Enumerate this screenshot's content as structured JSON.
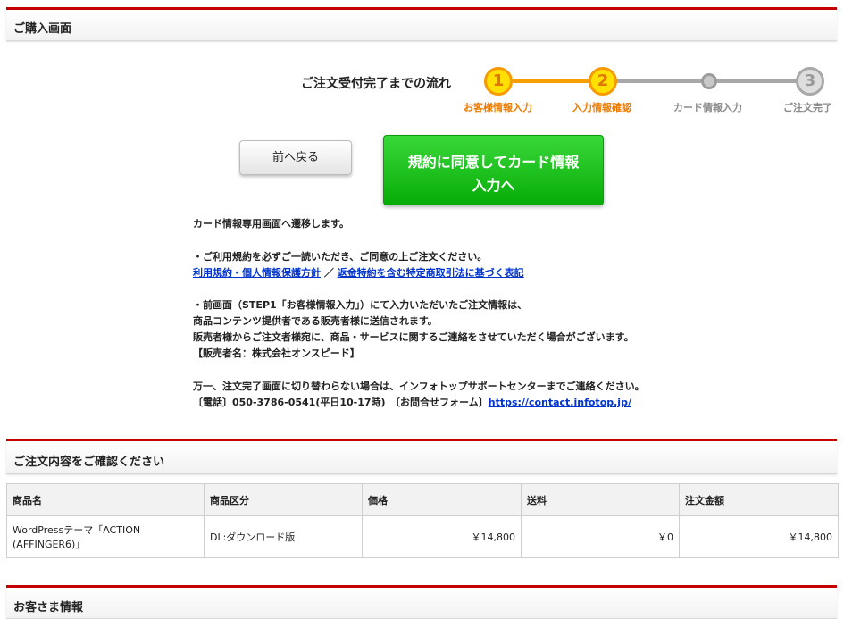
{
  "purchase_panel": {
    "title": "ご購入画面"
  },
  "flow": {
    "label": "ご注文受付完了までの流れ",
    "steps": [
      {
        "number": "1",
        "label": "お客様情報入力",
        "state": "done"
      },
      {
        "number": "2",
        "label": "入力情報確認",
        "state": "current"
      },
      {
        "number": "",
        "label": "カード情報入力",
        "state": "pending"
      },
      {
        "number": "3",
        "label": "ご注文完了",
        "state": "pending"
      }
    ],
    "colors": {
      "active": "#ffe000",
      "active_border": "#f59b00",
      "line_active": "#f5a000",
      "inactive": "#a8a8a8"
    }
  },
  "buttons": {
    "back": "前へ戻る",
    "proceed_line1": "規約に同意してカード情報",
    "proceed_line2": "入力へ"
  },
  "notes": {
    "redirect": "カード情報専用画面へ遷移します。",
    "terms_note": "・ご利用規約を必ずご一読いただき、ご同意の上ご注文ください。",
    "link_terms": "利用規約・個人情報保護方針",
    "separator": "／",
    "link_law": "返金特約を含む特定商取引法に基づく表記",
    "info_line1": "・前画面（STEP1「お客様情報入力」）にて入力いただいたご注文情報は、",
    "info_line2": "商品コンテンツ提供者である販売者様に送信されます。",
    "info_line3": "販売者様からご注文者様宛に、商品・サービスに関するご連絡をさせていただく場合がございます。",
    "info_line4": "【販売者名：株式会社オンスピード】",
    "support_line": "万一、注文完了画面に切り替わらない場合は、インフォトップサポートセンターまでご連絡ください。",
    "phone_text": "〔電話〕050-3786-0541(平日10-17時)　〔お問合せフォーム〕",
    "contact_link": "https://contact.infotop.jp/"
  },
  "order_panel": {
    "title": "ご注文内容をご確認ください"
  },
  "order_table": {
    "headers": [
      "商品名",
      "商品区分",
      "価格",
      "送料",
      "注文金額"
    ],
    "row": {
      "name_line1": "WordPressテーマ「ACTION",
      "name_line2": "(AFFINGER6)」",
      "category": "DL:ダウンロード版",
      "price": "￥14,800",
      "shipping": "￥0",
      "total": "￥14,800"
    }
  },
  "customer_panel": {
    "title": "お客さま情報"
  },
  "accent_color": "#c40000"
}
